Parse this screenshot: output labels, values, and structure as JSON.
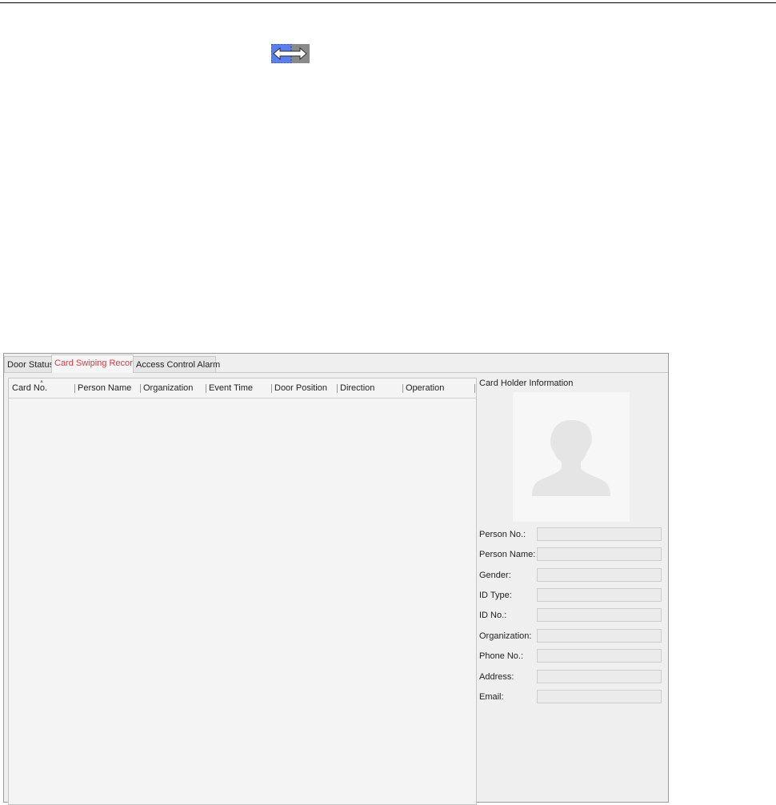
{
  "toolbar": {
    "swap_icon": "double-arrow-icon",
    "swap_colors": {
      "left": "#5a7ef0",
      "right": "#8a8a8a",
      "arrow": "#ffffff"
    }
  },
  "tabs": [
    {
      "label": "Door Status",
      "active": false
    },
    {
      "label": "Card Swiping Record",
      "active": true
    },
    {
      "label": "Access Control Alarm",
      "active": false
    }
  ],
  "table": {
    "columns": [
      "Card No.",
      "Person Name",
      "Organization",
      "Event Time",
      "Door Position",
      "Direction",
      "Operation"
    ],
    "rows": []
  },
  "card_holder": {
    "title": "Card Holder Information",
    "photo_icon": "person-silhouette-icon",
    "fields": [
      {
        "label": "Person No.:",
        "value": ""
      },
      {
        "label": "Person Name:",
        "value": ""
      },
      {
        "label": "Gender:",
        "value": ""
      },
      {
        "label": "ID Type:",
        "value": ""
      },
      {
        "label": "ID No.:",
        "value": ""
      },
      {
        "label": "Organization:",
        "value": ""
      },
      {
        "label": "Phone No.:",
        "value": ""
      },
      {
        "label": "Address:",
        "value": ""
      },
      {
        "label": "Email:",
        "value": ""
      }
    ]
  },
  "colors": {
    "active_tab_text": "#d9383e",
    "panel_bg": "#efefef",
    "table_bg": "#f4f4f4"
  }
}
